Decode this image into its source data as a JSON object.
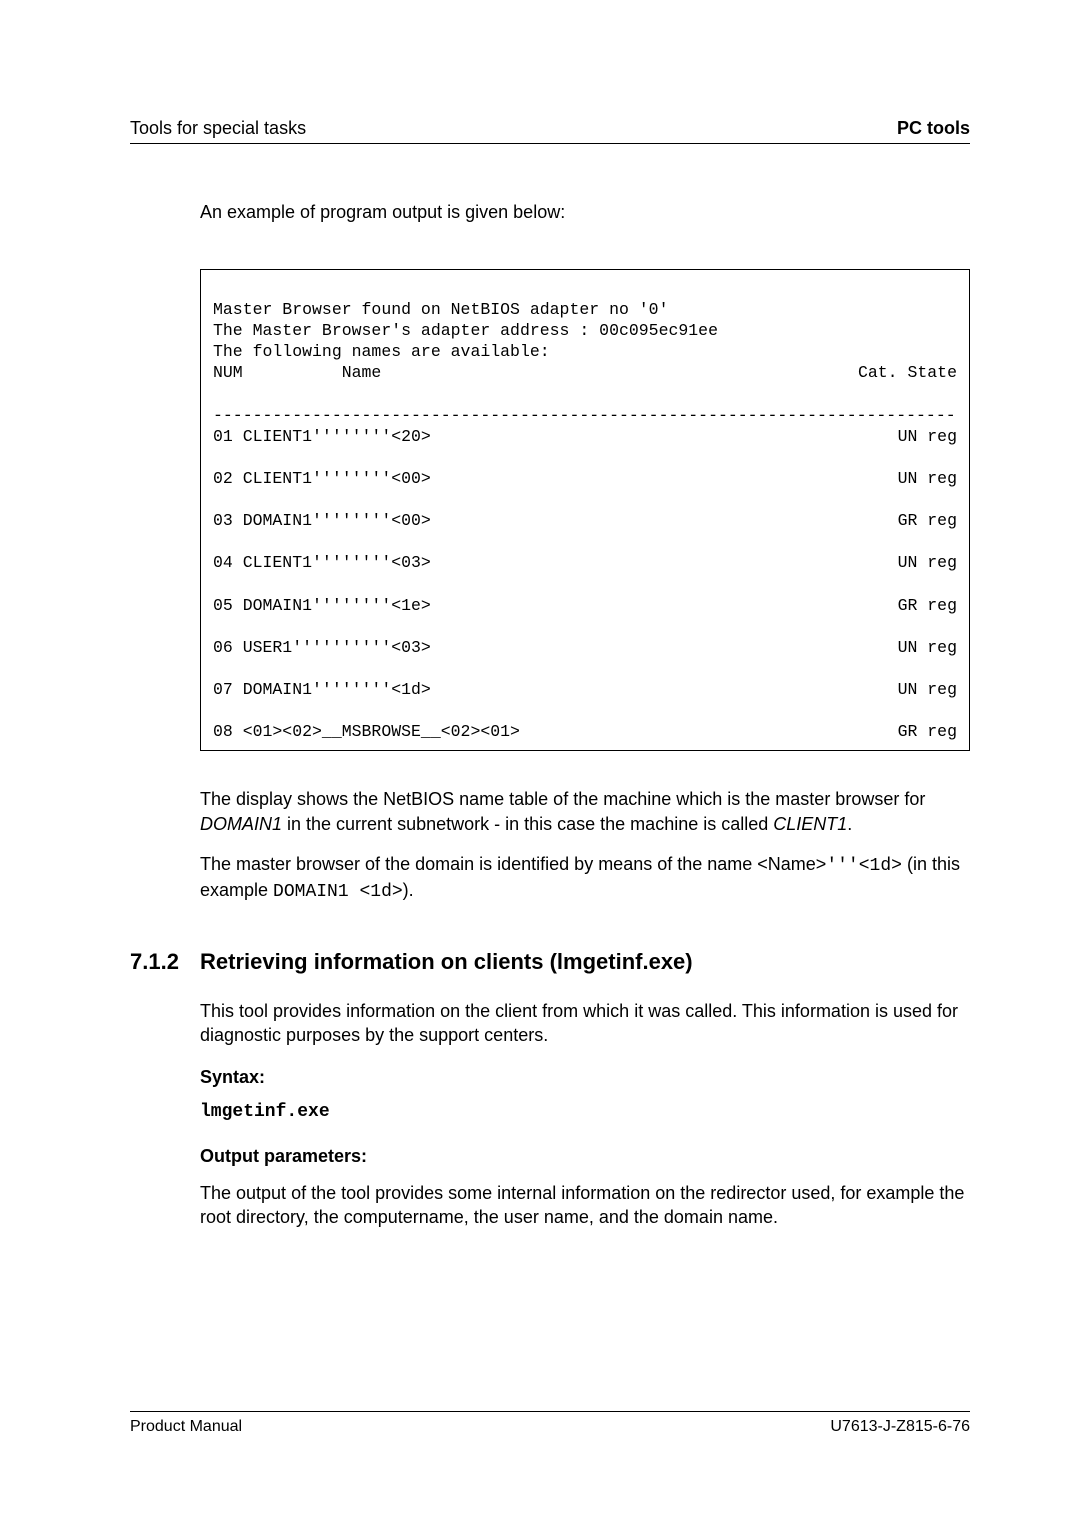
{
  "header": {
    "left": "Tools for special tasks",
    "right": "PC tools"
  },
  "intro": "An example of program output is given below:",
  "code": {
    "pre": [
      "Master Browser found on NetBIOS adapter no '0'",
      "The Master Browser's adapter address : 00c095ec91ee",
      "The following names are available:"
    ],
    "columns_left": "NUM          Name",
    "columns_right": "Cat. State",
    "rule": "---------------------------------------------------------------------------",
    "rows": [
      {
        "left": "01 CLIENT1''''''''<20>",
        "right": "UN reg"
      },
      {
        "left": "02 CLIENT1''''''''<00>",
        "right": "UN reg"
      },
      {
        "left": "03 DOMAIN1''''''''<00>",
        "right": "GR reg"
      },
      {
        "left": "04 CLIENT1''''''''<03>",
        "right": "UN reg"
      },
      {
        "left": "05 DOMAIN1''''''''<1e>",
        "right": "GR reg"
      },
      {
        "left": "06 USER1''''''''''<03>",
        "right": "UN reg"
      },
      {
        "left": "07 DOMAIN1''''''''<1d>",
        "right": "UN reg"
      },
      {
        "left": "08 <01><02>__MSBROWSE__<02><01>",
        "right": "GR reg"
      }
    ]
  },
  "body": {
    "p1_a": "The display shows the NetBIOS name table of the machine which is the master browser for ",
    "p1_domain": "DOMAIN1",
    "p1_b": " in the current subnetwork - in this case the machine is called ",
    "p1_client": "CLIENT1",
    "p1_c": ".",
    "p2_a": "The master browser of the domain is identified by means of the name <Name>",
    "p2_code1": "'''<1d>",
    "p2_b": " (in this example ",
    "p2_code2": "DOMAIN1 <1d>",
    "p2_c": ")."
  },
  "section": {
    "num": "7.1.2",
    "title": "Retrieving information on clients (lmgetinf.exe)",
    "desc": "This tool provides information on the client from which it was called. This information is used for diagnostic purposes by the support centers.",
    "syntax_label": "Syntax:",
    "syntax_cmd": "lmgetinf.exe",
    "outparam_label": "Output parameters:",
    "outparam_text": "The output of the tool provides some internal information on the redirector used, for example the root directory, the computername, the user name, and the domain name."
  },
  "footer": {
    "left": "Product Manual",
    "right": "U7613-J-Z815-6-76"
  }
}
